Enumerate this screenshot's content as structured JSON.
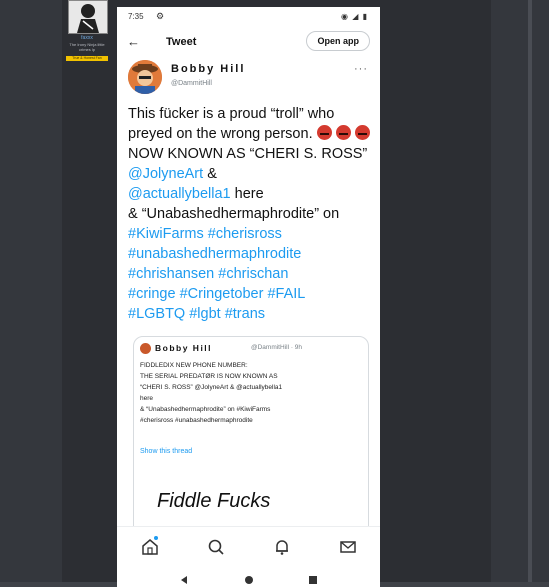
{
  "forum": {
    "username": "faxxx",
    "user_title": "The Irony Ninja little crimes lp",
    "badge": "True & Honest Fan"
  },
  "status_bar": {
    "time": "7:35"
  },
  "header": {
    "title": "Tweet",
    "open_app": "Open app"
  },
  "tweet": {
    "display_name": "Bobby Hill",
    "handle": "@DammitHill",
    "text_1": "This fücker is a proud “troll” who preyed on the wrong person.",
    "text_2": "NOW KNOWN AS “CHERI S. ROSS”",
    "mention_1": "@JolyneArt",
    "amp": "&",
    "mention_2": "@actuallybella1",
    "text_3": "here",
    "text_4": "& “Unabashedhermaphrodite” on",
    "hashtags_1": "#KiwiFarms #cherisross",
    "hashtags_2": "#unabashedhermaphrodite",
    "hashtags_3": "#chrishansen #chrischan",
    "hashtags_4": "#cringe #Cringetober #FAIL",
    "hashtags_5": "#LGBTQ #lgbt #trans"
  },
  "quote": {
    "display_name": "Bobby Hill",
    "handle_time": "@DammitHill · 9h",
    "line_1": "FIDDLEDIX NEW PHONE NUMBER:",
    "line_2": "THE SERIAL PREDATØR IS NOW KNOWN AS",
    "line_3": "“CHERI S. ROSS” @JolyneArt & @actuallybella1",
    "line_4": "here",
    "line_5": "& “Unabashedhermaphrodite” on #KiwiFarms",
    "line_6": "#cherisross #unabashedhermaphrodite",
    "show_thread": "Show this thread",
    "image_text": "Fiddle Fucks"
  },
  "colors": {
    "link": "#1d9bf0",
    "badge": "#f2c200"
  }
}
